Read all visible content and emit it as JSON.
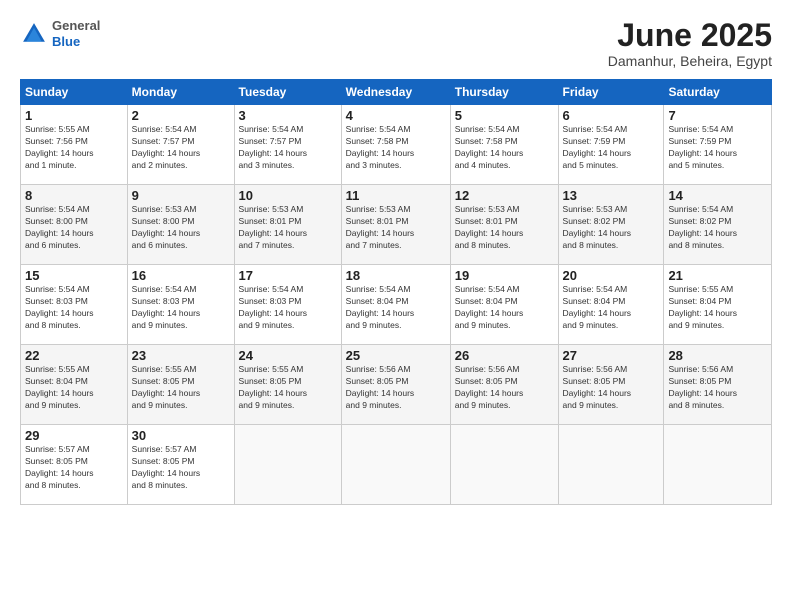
{
  "logo": {
    "general": "General",
    "blue": "Blue"
  },
  "title": "June 2025",
  "location": "Damanhur, Beheira, Egypt",
  "header_days": [
    "Sunday",
    "Monday",
    "Tuesday",
    "Wednesday",
    "Thursday",
    "Friday",
    "Saturday"
  ],
  "weeks": [
    [
      {
        "day": "1",
        "info": "Sunrise: 5:55 AM\nSunset: 7:56 PM\nDaylight: 14 hours\nand 1 minute."
      },
      {
        "day": "2",
        "info": "Sunrise: 5:54 AM\nSunset: 7:57 PM\nDaylight: 14 hours\nand 2 minutes."
      },
      {
        "day": "3",
        "info": "Sunrise: 5:54 AM\nSunset: 7:57 PM\nDaylight: 14 hours\nand 3 minutes."
      },
      {
        "day": "4",
        "info": "Sunrise: 5:54 AM\nSunset: 7:58 PM\nDaylight: 14 hours\nand 3 minutes."
      },
      {
        "day": "5",
        "info": "Sunrise: 5:54 AM\nSunset: 7:58 PM\nDaylight: 14 hours\nand 4 minutes."
      },
      {
        "day": "6",
        "info": "Sunrise: 5:54 AM\nSunset: 7:59 PM\nDaylight: 14 hours\nand 5 minutes."
      },
      {
        "day": "7",
        "info": "Sunrise: 5:54 AM\nSunset: 7:59 PM\nDaylight: 14 hours\nand 5 minutes."
      }
    ],
    [
      {
        "day": "8",
        "info": "Sunrise: 5:54 AM\nSunset: 8:00 PM\nDaylight: 14 hours\nand 6 minutes."
      },
      {
        "day": "9",
        "info": "Sunrise: 5:53 AM\nSunset: 8:00 PM\nDaylight: 14 hours\nand 6 minutes."
      },
      {
        "day": "10",
        "info": "Sunrise: 5:53 AM\nSunset: 8:01 PM\nDaylight: 14 hours\nand 7 minutes."
      },
      {
        "day": "11",
        "info": "Sunrise: 5:53 AM\nSunset: 8:01 PM\nDaylight: 14 hours\nand 7 minutes."
      },
      {
        "day": "12",
        "info": "Sunrise: 5:53 AM\nSunset: 8:01 PM\nDaylight: 14 hours\nand 8 minutes."
      },
      {
        "day": "13",
        "info": "Sunrise: 5:53 AM\nSunset: 8:02 PM\nDaylight: 14 hours\nand 8 minutes."
      },
      {
        "day": "14",
        "info": "Sunrise: 5:54 AM\nSunset: 8:02 PM\nDaylight: 14 hours\nand 8 minutes."
      }
    ],
    [
      {
        "day": "15",
        "info": "Sunrise: 5:54 AM\nSunset: 8:03 PM\nDaylight: 14 hours\nand 8 minutes."
      },
      {
        "day": "16",
        "info": "Sunrise: 5:54 AM\nSunset: 8:03 PM\nDaylight: 14 hours\nand 9 minutes."
      },
      {
        "day": "17",
        "info": "Sunrise: 5:54 AM\nSunset: 8:03 PM\nDaylight: 14 hours\nand 9 minutes."
      },
      {
        "day": "18",
        "info": "Sunrise: 5:54 AM\nSunset: 8:04 PM\nDaylight: 14 hours\nand 9 minutes."
      },
      {
        "day": "19",
        "info": "Sunrise: 5:54 AM\nSunset: 8:04 PM\nDaylight: 14 hours\nand 9 minutes."
      },
      {
        "day": "20",
        "info": "Sunrise: 5:54 AM\nSunset: 8:04 PM\nDaylight: 14 hours\nand 9 minutes."
      },
      {
        "day": "21",
        "info": "Sunrise: 5:55 AM\nSunset: 8:04 PM\nDaylight: 14 hours\nand 9 minutes."
      }
    ],
    [
      {
        "day": "22",
        "info": "Sunrise: 5:55 AM\nSunset: 8:04 PM\nDaylight: 14 hours\nand 9 minutes."
      },
      {
        "day": "23",
        "info": "Sunrise: 5:55 AM\nSunset: 8:05 PM\nDaylight: 14 hours\nand 9 minutes."
      },
      {
        "day": "24",
        "info": "Sunrise: 5:55 AM\nSunset: 8:05 PM\nDaylight: 14 hours\nand 9 minutes."
      },
      {
        "day": "25",
        "info": "Sunrise: 5:56 AM\nSunset: 8:05 PM\nDaylight: 14 hours\nand 9 minutes."
      },
      {
        "day": "26",
        "info": "Sunrise: 5:56 AM\nSunset: 8:05 PM\nDaylight: 14 hours\nand 9 minutes."
      },
      {
        "day": "27",
        "info": "Sunrise: 5:56 AM\nSunset: 8:05 PM\nDaylight: 14 hours\nand 9 minutes."
      },
      {
        "day": "28",
        "info": "Sunrise: 5:56 AM\nSunset: 8:05 PM\nDaylight: 14 hours\nand 8 minutes."
      }
    ],
    [
      {
        "day": "29",
        "info": "Sunrise: 5:57 AM\nSunset: 8:05 PM\nDaylight: 14 hours\nand 8 minutes."
      },
      {
        "day": "30",
        "info": "Sunrise: 5:57 AM\nSunset: 8:05 PM\nDaylight: 14 hours\nand 8 minutes."
      },
      {
        "day": "",
        "info": ""
      },
      {
        "day": "",
        "info": ""
      },
      {
        "day": "",
        "info": ""
      },
      {
        "day": "",
        "info": ""
      },
      {
        "day": "",
        "info": ""
      }
    ]
  ]
}
